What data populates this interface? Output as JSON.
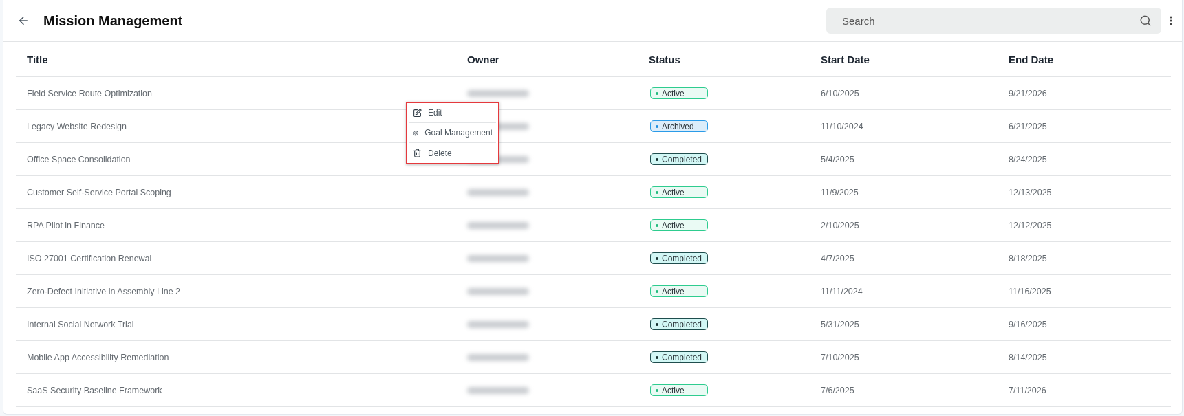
{
  "header": {
    "title": "Mission Management",
    "search": {
      "placeholder": "Search"
    }
  },
  "table": {
    "columns": [
      "Title",
      "Owner",
      "Status",
      "Start Date",
      "End Date"
    ],
    "rows": [
      {
        "title": "Field Service Route Optimization",
        "status": {
          "label": "Active",
          "kind": "active"
        },
        "start": "6/10/2025",
        "end": "9/21/2026"
      },
      {
        "title": "Legacy Website Redesign",
        "status": {
          "label": "Archived",
          "kind": "archived"
        },
        "start": "11/10/2024",
        "end": "6/21/2025"
      },
      {
        "title": "Office Space Consolidation",
        "status": {
          "label": "Completed",
          "kind": "completed"
        },
        "start": "5/4/2025",
        "end": "8/24/2025"
      },
      {
        "title": "Customer Self-Service Portal Scoping",
        "status": {
          "label": "Active",
          "kind": "active"
        },
        "start": "11/9/2025",
        "end": "12/13/2025"
      },
      {
        "title": "RPA Pilot in Finance",
        "status": {
          "label": "Active",
          "kind": "active"
        },
        "start": "2/10/2025",
        "end": "12/12/2025"
      },
      {
        "title": "ISO 27001 Certification Renewal",
        "status": {
          "label": "Completed",
          "kind": "completed"
        },
        "start": "4/7/2025",
        "end": "8/18/2025"
      },
      {
        "title": "Zero-Defect Initiative in Assembly Line 2",
        "status": {
          "label": "Active",
          "kind": "active"
        },
        "start": "11/11/2024",
        "end": "11/16/2025"
      },
      {
        "title": "Internal Social Network Trial",
        "status": {
          "label": "Completed",
          "kind": "completed"
        },
        "start": "5/31/2025",
        "end": "9/16/2025"
      },
      {
        "title": "Mobile App Accessibility Remediation",
        "status": {
          "label": "Completed",
          "kind": "completed"
        },
        "start": "7/10/2025",
        "end": "8/14/2025"
      },
      {
        "title": "SaaS Security Baseline Framework",
        "status": {
          "label": "Active",
          "kind": "active"
        },
        "start": "7/6/2025",
        "end": "7/11/2026"
      }
    ]
  },
  "context_menu": {
    "items": [
      {
        "label": "Edit",
        "kind": "edit"
      },
      {
        "label": "Goal Management",
        "kind": "goal"
      },
      {
        "label": "Delete",
        "kind": "delete"
      }
    ]
  }
}
